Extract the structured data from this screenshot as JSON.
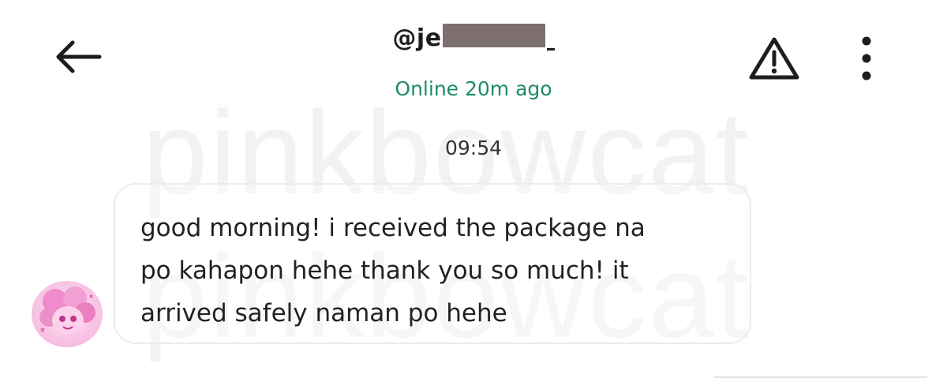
{
  "header": {
    "username_visible_prefix": "@je",
    "status": "Online 20m ago"
  },
  "watermark": {
    "text": "pinkbowcat"
  },
  "icons": {
    "back": "arrow-left-icon",
    "report": "warning-triangle-icon",
    "more": "more-vertical-icon"
  },
  "conversation": {
    "timestamp": "09:54",
    "messages": [
      {
        "sender": "other",
        "lines": [
          "good morning! i received the package na",
          "po kahapon hehe thank you so much! it",
          "arrived safely naman po hehe"
        ]
      }
    ]
  },
  "colors": {
    "status_green": "#1c8c6b",
    "redaction": "#7d6f6f",
    "bubble_border": "#ececec"
  }
}
